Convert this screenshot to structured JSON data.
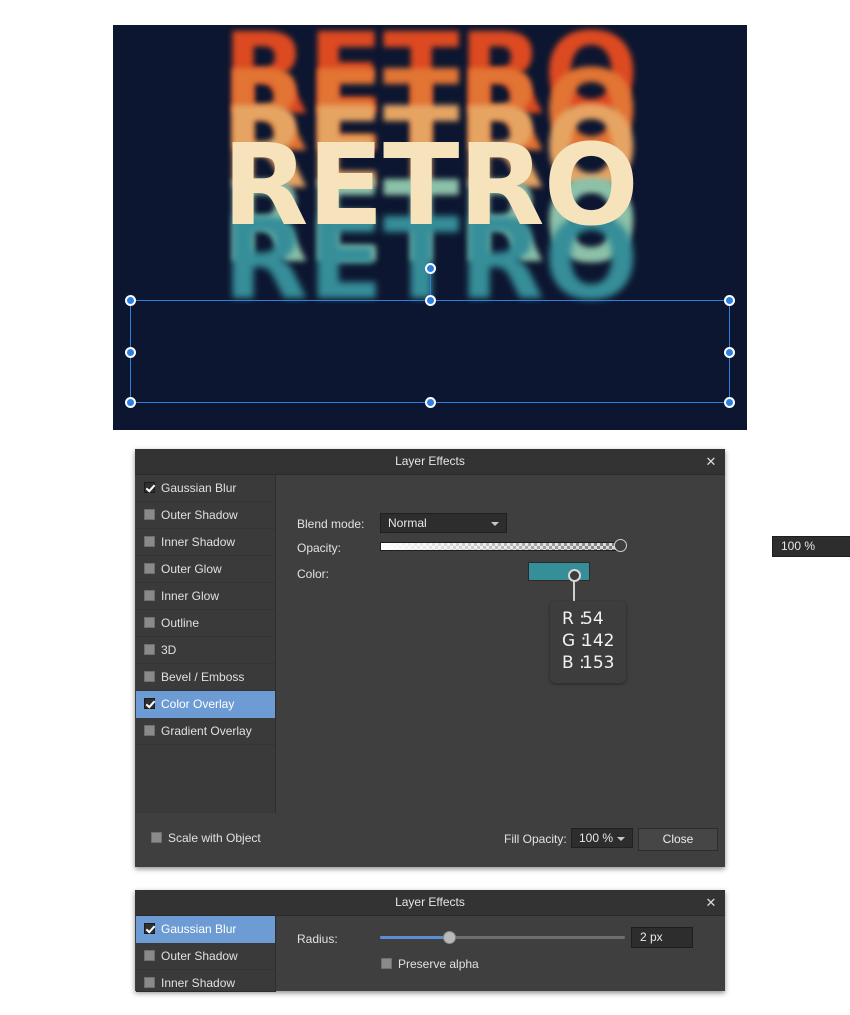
{
  "canvas": {
    "background_color": "#0d1630",
    "artwork_text": "RETRO",
    "layers": [
      {
        "text": "RETRO",
        "color": "#dd4a21",
        "blurred": true
      },
      {
        "text": "RETRO",
        "color": "#e27434",
        "blurred": true
      },
      {
        "text": "RETRO",
        "color": "#e6a463",
        "blurred": true
      },
      {
        "text": "RETRO",
        "color": "#f7e3bb",
        "blurred": false
      },
      {
        "text": "RETRO",
        "color": "#8cc1a9",
        "blurred": true
      },
      {
        "text": "RETRO",
        "color": "#368e99",
        "blurred": true
      }
    ],
    "selection_color": "#2d7fe0"
  },
  "dialog_main": {
    "title": "Layer Effects",
    "close_label": "✕",
    "effects": [
      {
        "label": "Gaussian Blur",
        "checked": true,
        "selected": false
      },
      {
        "label": "Outer Shadow",
        "checked": false,
        "selected": false
      },
      {
        "label": "Inner Shadow",
        "checked": false,
        "selected": false
      },
      {
        "label": "Outer Glow",
        "checked": false,
        "selected": false
      },
      {
        "label": "Inner Glow",
        "checked": false,
        "selected": false
      },
      {
        "label": "Outline",
        "checked": false,
        "selected": false
      },
      {
        "label": "3D",
        "checked": false,
        "selected": false
      },
      {
        "label": "Bevel / Emboss",
        "checked": false,
        "selected": false
      },
      {
        "label": "Color Overlay",
        "checked": true,
        "selected": true
      },
      {
        "label": "Gradient Overlay",
        "checked": false,
        "selected": false
      }
    ],
    "blend_mode_label": "Blend mode:",
    "blend_mode_value": "Normal",
    "opacity_label": "Opacity:",
    "opacity_value": "100 %",
    "opacity_percent": 100,
    "color_label": "Color:",
    "color_value": "#368e99",
    "rgb_tooltip": {
      "r_key": "R :",
      "r_value": "54",
      "g_key": "G :",
      "g_value": "142",
      "b_key": "B :",
      "b_value": "153"
    },
    "scale_with_object_label": "Scale with Object",
    "scale_with_object_checked": false,
    "fill_opacity_label": "Fill Opacity:",
    "fill_opacity_value": "100 %",
    "close_button_label": "Close",
    "selected_row_color": "#6d9bd4"
  },
  "dialog_blur": {
    "title": "Layer Effects",
    "close_label": "✕",
    "effects": [
      {
        "label": "Gaussian Blur",
        "checked": true,
        "selected": true
      },
      {
        "label": "Outer Shadow",
        "checked": false,
        "selected": false
      },
      {
        "label": "Inner Shadow",
        "checked": false,
        "selected": false
      }
    ],
    "radius_label": "Radius:",
    "radius_value": "2 px",
    "radius_percent": 28,
    "preserve_alpha_label": "Preserve alpha",
    "preserve_alpha_checked": false,
    "accent_color": "#5a8fd6"
  }
}
